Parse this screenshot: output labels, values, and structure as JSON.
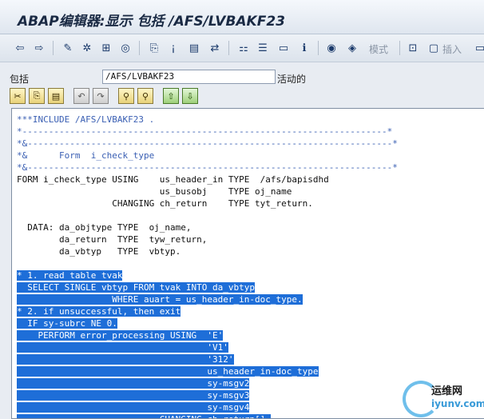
{
  "window": {
    "title": "ABAP编辑器:显示 包括 /AFS/LVBAKF23"
  },
  "toolbar": {
    "mode_label": "模式",
    "insert_label": "插入"
  },
  "field": {
    "label": "包括",
    "value": "/AFS/LVBAKF23",
    "status": "活动的"
  },
  "code_lines": [
    {
      "text": "***INCLUDE /AFS/LVBAKF23 .",
      "type": "comment",
      "selected": false
    },
    {
      "text": "*---------------------------------------------------------------------*",
      "type": "comment",
      "selected": false
    },
    {
      "text": "*&---------------------------------------------------------------------*",
      "type": "comment",
      "selected": false
    },
    {
      "text": "*&      Form  i_check_type",
      "type": "comment",
      "selected": false
    },
    {
      "text": "*&---------------------------------------------------------------------*",
      "type": "comment",
      "selected": false
    },
    {
      "text": "FORM i_check_type USING    us_header_in TYPE  /afs/bapisdhd",
      "type": "code",
      "selected": false
    },
    {
      "text": "                           us_busobj    TYPE oj_name",
      "type": "code",
      "selected": false
    },
    {
      "text": "                  CHANGING ch_return    TYPE tyt_return.",
      "type": "code",
      "selected": false
    },
    {
      "text": "",
      "type": "code",
      "selected": false
    },
    {
      "text": "  DATA: da_objtype TYPE  oj_name,",
      "type": "code",
      "selected": false
    },
    {
      "text": "        da_return  TYPE  tyw_return,",
      "type": "code",
      "selected": false
    },
    {
      "text": "        da_vbtyp   TYPE  vbtyp.",
      "type": "code",
      "selected": false
    },
    {
      "text": "",
      "type": "code",
      "selected": false
    },
    {
      "text": "* 1. read table tvak",
      "type": "comment",
      "selected": true
    },
    {
      "text": "  SELECT SINGLE vbtyp FROM tvak INTO da_vbtyp",
      "type": "code",
      "selected": true
    },
    {
      "text": "                  WHERE auart = us_header_in-doc_type.",
      "type": "code",
      "selected": true
    },
    {
      "text": "* 2. if unsuccessful, then exit",
      "type": "comment",
      "selected": true
    },
    {
      "text": "  IF sy-subrc NE 0.",
      "type": "code",
      "selected": true
    },
    {
      "text": "    PERFORM error_processing USING  'E'",
      "type": "code",
      "selected": true
    },
    {
      "text": "                                    'V1'",
      "type": "code",
      "selected": true
    },
    {
      "text": "                                    '312'",
      "type": "code",
      "selected": true
    },
    {
      "text": "                                    us_header_in-doc_type",
      "type": "code",
      "selected": true
    },
    {
      "text": "                                    sy-msgv2",
      "type": "code",
      "selected": true
    },
    {
      "text": "                                    sy-msgv3",
      "type": "code",
      "selected": true
    },
    {
      "text": "                                    sy-msgv4",
      "type": "code",
      "selected": true
    },
    {
      "text": "                           CHANGING ch_return[].",
      "type": "code",
      "selected": true
    }
  ],
  "watermark": {
    "line1": "运维网",
    "line2": "iyunv.com"
  }
}
